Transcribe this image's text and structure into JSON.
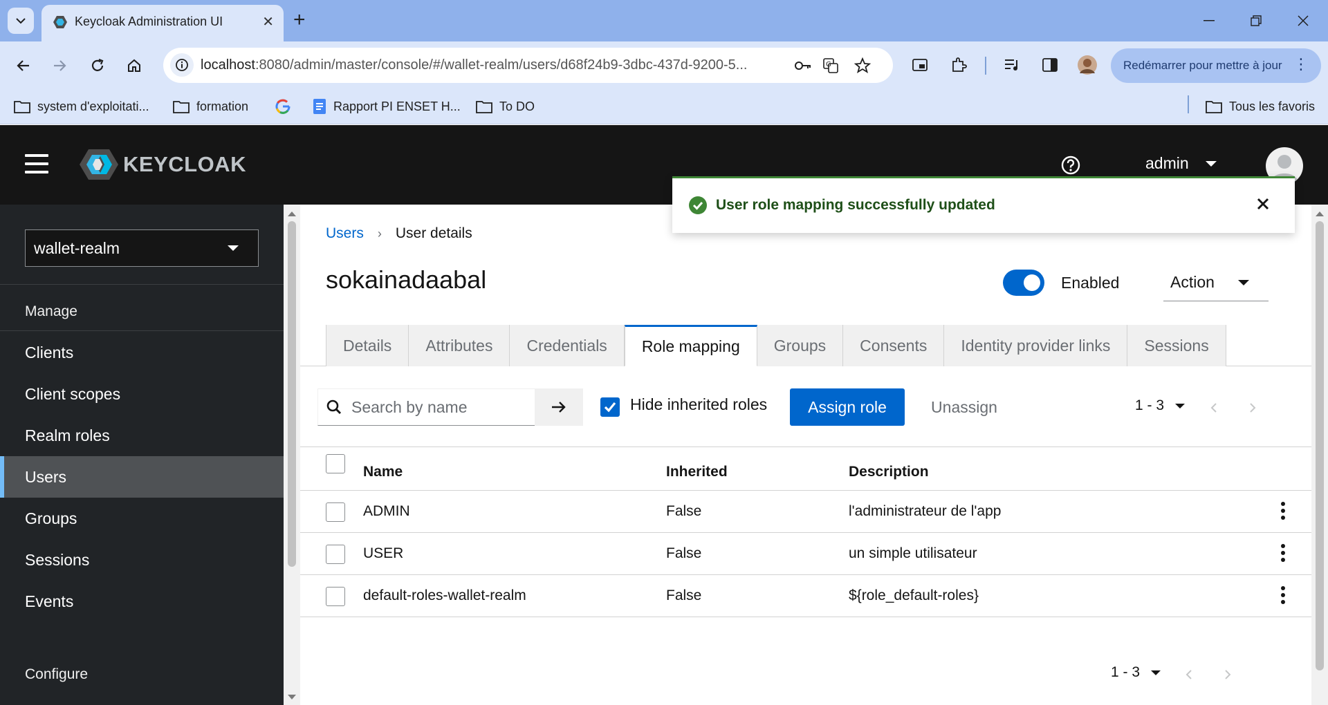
{
  "browser": {
    "tab_title": "Keycloak Administration UI",
    "url_host": "localhost",
    "url_path": ":8080/admin/master/console/#/wallet-realm/users/d68f24b9-3dbc-437d-9200-5...",
    "update_button": "Redémarrer pour mettre à jour",
    "bookmarks": [
      "system d'exploitati...",
      "formation",
      "Rapport PI ENSET H...",
      "To DO"
    ],
    "all_bookmarks": "Tous les favoris"
  },
  "header": {
    "brand": "KEYCLOAK",
    "username": "admin"
  },
  "sidebar": {
    "realm": "wallet-realm",
    "manage_label": "Manage",
    "items": [
      "Clients",
      "Client scopes",
      "Realm roles",
      "Users",
      "Groups",
      "Sessions",
      "Events"
    ],
    "configure_label": "Configure"
  },
  "main": {
    "breadcrumb": {
      "parent": "Users",
      "current": "User details"
    },
    "title": "sokainadaabal",
    "enabled_label": "Enabled",
    "action_label": "Action",
    "tabs": [
      "Details",
      "Attributes",
      "Credentials",
      "Role mapping",
      "Groups",
      "Consents",
      "Identity provider links",
      "Sessions"
    ],
    "search_placeholder": "Search by name",
    "hide_inherited_label": "Hide inherited roles",
    "assign_label": "Assign role",
    "unassign_label": "Unassign",
    "pagination": "1 - 3",
    "columns": {
      "name": "Name",
      "inherited": "Inherited",
      "description": "Description"
    },
    "rows": [
      {
        "name": "ADMIN",
        "inherited": "False",
        "description": "l'administrateur de l'app"
      },
      {
        "name": "USER",
        "inherited": "False",
        "description": "un simple utilisateur"
      },
      {
        "name": "default-roles-wallet-realm",
        "inherited": "False",
        "description": "${role_default-roles}"
      }
    ]
  },
  "toast": {
    "message": "User role mapping successfully updated"
  },
  "colors": {
    "accent": "#0066cc",
    "success": "#3e8635",
    "header_bg": "#151515",
    "sidebar_bg": "#212427"
  }
}
